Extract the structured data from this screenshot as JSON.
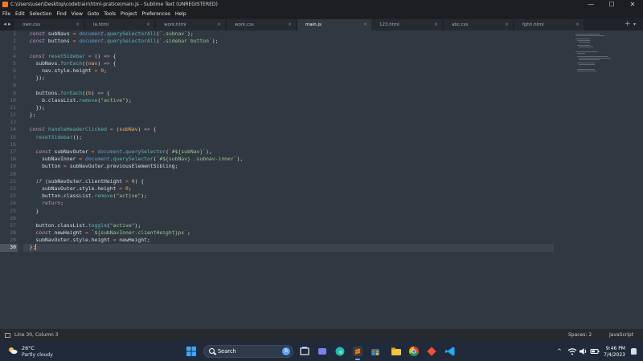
{
  "window": {
    "title": "C:\\Users\\user\\Desktop\\codetrain\\html-pratice\\main.js - Sublime Text (UNREGISTERED)",
    "minimize_glyph": "—",
    "maximize_glyph": "☐",
    "close_glyph": "✕"
  },
  "menu": [
    "File",
    "Edit",
    "Selection",
    "Find",
    "View",
    "Goto",
    "Tools",
    "Project",
    "Preferences",
    "Help"
  ],
  "tabs": [
    {
      "label": "own.css"
    },
    {
      "label": "la.html"
    },
    {
      "label": "work.html"
    },
    {
      "label": "work.css"
    },
    {
      "label": "main.js",
      "active": true
    },
    {
      "label": "123.html"
    },
    {
      "label": "abc.css"
    },
    {
      "label": "fghh.html"
    }
  ],
  "tab_close_glyph": "×",
  "tab_nav_glyph": "◂ ▸",
  "tab_new_glyph": "+",
  "tab_more_glyph": "▾",
  "editor": {
    "line_numbers": [
      "1",
      "2",
      "3",
      "4",
      "5",
      "6",
      "7",
      "8",
      "9",
      "10",
      "11",
      "12",
      "13",
      "14",
      "15",
      "16",
      "17",
      "18",
      "19",
      "20",
      "21",
      "22",
      "23",
      "24",
      "25",
      "26",
      "27",
      "28",
      "29",
      "30"
    ],
    "current_line": 30
  },
  "status": {
    "position": "Line 30, Column 3",
    "spaces": "Spaces: 2",
    "syntax": "JavaScript"
  },
  "taskbar": {
    "temperature": "26°C",
    "weather": "Partly cloudy",
    "search_label": "Search",
    "search_badge": "b",
    "tray_chevron": "^",
    "time": "9:46 PM",
    "date": "7/4/2023"
  },
  "colors": {
    "editor_bg": "#303841",
    "keyword": "#c695c6",
    "function": "#5fb3b3",
    "string": "#99c794",
    "number": "#f9ae58",
    "operator": "#f97b58",
    "tabbar_bg": "#1f2328",
    "taskbar_bg": "#202a3a"
  },
  "icons": {
    "app": "sublime-text-icon",
    "weather": "partly-cloudy-icon",
    "start": "windows-start-icon",
    "tray": [
      "wifi-icon",
      "speaker-icon",
      "battery-icon"
    ]
  }
}
